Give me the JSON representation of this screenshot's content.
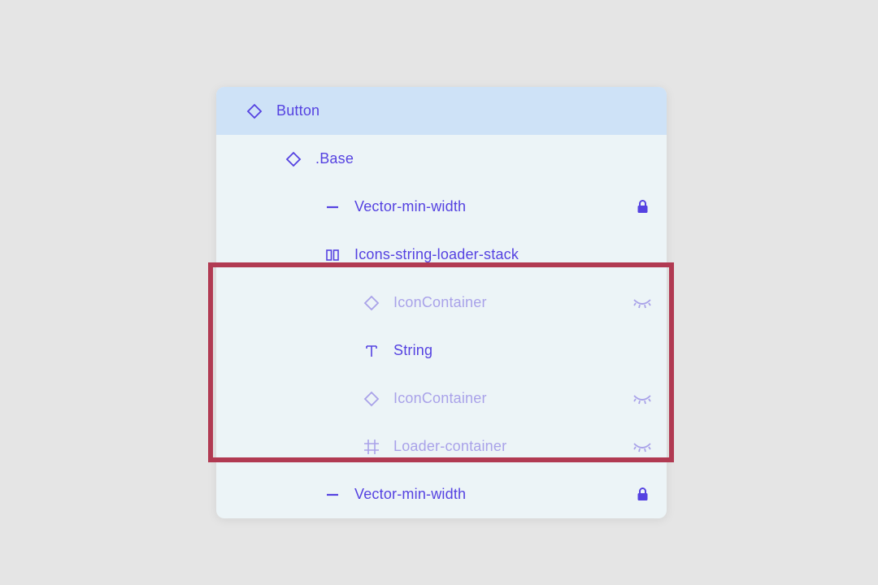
{
  "rows": [
    {
      "label": "Button",
      "icon": "diamond",
      "indent": 0,
      "selected": true,
      "muted": false,
      "trailing": null
    },
    {
      "label": ".Base",
      "icon": "diamond",
      "indent": 1,
      "selected": false,
      "muted": false,
      "trailing": null
    },
    {
      "label": "Vector-min-width",
      "icon": "line",
      "indent": 2,
      "selected": false,
      "muted": false,
      "trailing": "lock"
    },
    {
      "label": "Icons-string-loader-stack",
      "icon": "stack",
      "indent": 2,
      "selected": false,
      "muted": false,
      "trailing": null
    },
    {
      "label": "IconContainer",
      "icon": "diamond",
      "indent": 3,
      "selected": false,
      "muted": true,
      "trailing": "hidden"
    },
    {
      "label": "String",
      "icon": "text",
      "indent": 3,
      "selected": false,
      "muted": false,
      "trailing": null
    },
    {
      "label": "IconContainer",
      "icon": "diamond",
      "indent": 3,
      "selected": false,
      "muted": true,
      "trailing": "hidden"
    },
    {
      "label": "Loader-container",
      "icon": "frame",
      "indent": 3,
      "selected": false,
      "muted": true,
      "trailing": "hidden"
    },
    {
      "label": "Vector-min-width",
      "icon": "line",
      "indent": 2,
      "selected": false,
      "muted": false,
      "trailing": "lock"
    }
  ],
  "colors": {
    "accent": "#5542e1",
    "muted": "#a9a2e9",
    "highlight": "#b13a52"
  },
  "highlight_box": {
    "covers_rows": [
      4,
      5,
      6,
      7
    ]
  }
}
